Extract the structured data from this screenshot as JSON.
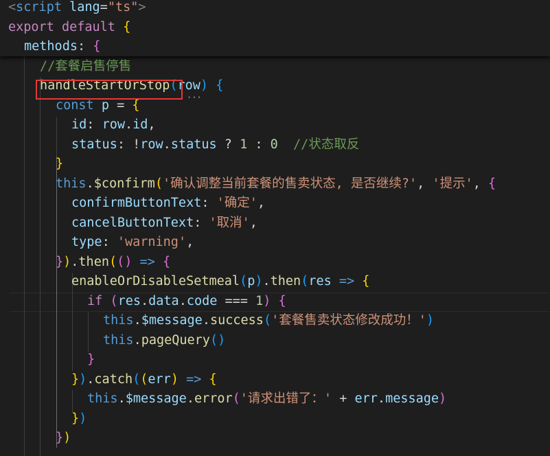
{
  "editor": {
    "language": "ts",
    "lines": [
      {
        "indent": 0,
        "tokens": [
          [
            "c-tag",
            "<"
          ],
          [
            "c-tagname",
            "script"
          ],
          [
            "c-op",
            " "
          ],
          [
            "c-attr",
            "lang"
          ],
          [
            "c-op",
            "="
          ],
          [
            "c-str",
            "\"ts\""
          ],
          [
            "c-tag",
            ">"
          ]
        ]
      },
      {
        "indent": 0,
        "tokens": [
          [
            "c-kw",
            "export"
          ],
          [
            "c-op",
            " "
          ],
          [
            "c-kw",
            "default"
          ],
          [
            "c-op",
            " "
          ],
          [
            "c-brace1",
            "{"
          ]
        ]
      },
      {
        "indent": 1,
        "tokens": [
          [
            "c-prop",
            "methods"
          ],
          [
            "c-op",
            ": "
          ],
          [
            "c-brace2",
            "{"
          ]
        ]
      },
      {
        "indent": 2,
        "tokens": [
          [
            "c-comment",
            "//套餐启售停售"
          ]
        ]
      },
      {
        "indent": 2,
        "tokens": [
          [
            "c-fn",
            "handleStartOrStop"
          ],
          [
            "c-brace3",
            "("
          ],
          [
            "c-var",
            "row"
          ],
          [
            "c-brace3",
            ")"
          ],
          [
            "c-op",
            " "
          ],
          [
            "c-brace3",
            "{"
          ]
        ]
      },
      {
        "indent": 3,
        "tokens": [
          [
            "c-kw2",
            "const"
          ],
          [
            "c-op",
            " "
          ],
          [
            "c-var",
            "p"
          ],
          [
            "c-op",
            " = "
          ],
          [
            "c-brace1",
            "{"
          ]
        ]
      },
      {
        "indent": 4,
        "tokens": [
          [
            "c-prop",
            "id"
          ],
          [
            "c-op",
            ": "
          ],
          [
            "c-var",
            "row"
          ],
          [
            "c-op",
            "."
          ],
          [
            "c-prop",
            "id"
          ],
          [
            "c-op",
            ","
          ]
        ]
      },
      {
        "indent": 4,
        "tokens": [
          [
            "c-prop",
            "status"
          ],
          [
            "c-op",
            ": !"
          ],
          [
            "c-var",
            "row"
          ],
          [
            "c-op",
            "."
          ],
          [
            "c-prop",
            "status"
          ],
          [
            "c-op",
            " ? "
          ],
          [
            "c-num",
            "1"
          ],
          [
            "c-op",
            " : "
          ],
          [
            "c-num",
            "0"
          ],
          [
            "c-op",
            "  "
          ],
          [
            "c-comment",
            "//状态取反"
          ]
        ]
      },
      {
        "indent": 3,
        "tokens": [
          [
            "c-brace1",
            "}"
          ]
        ]
      },
      {
        "indent": 3,
        "tokens": [
          [
            "c-this",
            "this"
          ],
          [
            "c-op",
            "."
          ],
          [
            "c-fn",
            "$confirm"
          ],
          [
            "c-brace1",
            "("
          ],
          [
            "c-str",
            "'确认调整当前套餐的售卖状态, 是否继续?'"
          ],
          [
            "c-op",
            ", "
          ],
          [
            "c-str",
            "'提示'"
          ],
          [
            "c-op",
            ", "
          ],
          [
            "c-brace2",
            "{"
          ]
        ]
      },
      {
        "indent": 4,
        "tokens": [
          [
            "c-prop",
            "confirmButtonText"
          ],
          [
            "c-op",
            ": "
          ],
          [
            "c-str",
            "'确定'"
          ],
          [
            "c-op",
            ","
          ]
        ]
      },
      {
        "indent": 4,
        "tokens": [
          [
            "c-prop",
            "cancelButtonText"
          ],
          [
            "c-op",
            ": "
          ],
          [
            "c-str",
            "'取消'"
          ],
          [
            "c-op",
            ","
          ]
        ]
      },
      {
        "indent": 4,
        "tokens": [
          [
            "c-prop",
            "type"
          ],
          [
            "c-op",
            ": "
          ],
          [
            "c-str",
            "'warning'"
          ],
          [
            "c-op",
            ","
          ]
        ]
      },
      {
        "indent": 3,
        "tokens": [
          [
            "c-brace2",
            "}"
          ],
          [
            "c-brace1",
            ")"
          ],
          [
            "c-op",
            "."
          ],
          [
            "c-fn",
            "then"
          ],
          [
            "c-brace1",
            "("
          ],
          [
            "c-brace2",
            "("
          ],
          [
            "c-brace2",
            ")"
          ],
          [
            "c-op",
            " "
          ],
          [
            "c-kw2",
            "=>"
          ],
          [
            "c-op",
            " "
          ],
          [
            "c-brace2",
            "{"
          ]
        ]
      },
      {
        "indent": 4,
        "tokens": [
          [
            "c-fn",
            "enableOrDisableSetmeal"
          ],
          [
            "c-brace3",
            "("
          ],
          [
            "c-var",
            "p"
          ],
          [
            "c-brace3",
            ")"
          ],
          [
            "c-op",
            "."
          ],
          [
            "c-fn",
            "then"
          ],
          [
            "c-brace3",
            "("
          ],
          [
            "c-var",
            "res"
          ],
          [
            "c-op",
            " "
          ],
          [
            "c-kw2",
            "=>"
          ],
          [
            "c-op",
            " "
          ],
          [
            "c-brace1",
            "{"
          ]
        ]
      },
      {
        "indent": 5,
        "tokens": [
          [
            "c-kw",
            "if"
          ],
          [
            "c-op",
            " "
          ],
          [
            "c-brace2",
            "("
          ],
          [
            "c-var",
            "res"
          ],
          [
            "c-op",
            "."
          ],
          [
            "c-prop",
            "data"
          ],
          [
            "c-op",
            "."
          ],
          [
            "c-prop",
            "code"
          ],
          [
            "c-op",
            " === "
          ],
          [
            "c-num",
            "1"
          ],
          [
            "c-brace2",
            ")"
          ],
          [
            "c-op",
            " "
          ],
          [
            "c-brace2",
            "{"
          ]
        ]
      },
      {
        "indent": 6,
        "tokens": [
          [
            "c-this",
            "this"
          ],
          [
            "c-op",
            "."
          ],
          [
            "c-var",
            "$message"
          ],
          [
            "c-op",
            "."
          ],
          [
            "c-fn",
            "success"
          ],
          [
            "c-brace3",
            "("
          ],
          [
            "c-str",
            "'套餐售卖状态修改成功！'"
          ],
          [
            "c-brace3",
            ")"
          ]
        ]
      },
      {
        "indent": 6,
        "tokens": [
          [
            "c-this",
            "this"
          ],
          [
            "c-op",
            "."
          ],
          [
            "c-fn",
            "pageQuery"
          ],
          [
            "c-brace3",
            "("
          ],
          [
            "c-brace3",
            ")"
          ]
        ]
      },
      {
        "indent": 5,
        "tokens": [
          [
            "c-brace2",
            "}"
          ]
        ]
      },
      {
        "indent": 4,
        "tokens": [
          [
            "c-brace1",
            "}"
          ],
          [
            "c-brace3",
            ")"
          ],
          [
            "c-op",
            "."
          ],
          [
            "c-fn",
            "catch"
          ],
          [
            "c-brace3",
            "("
          ],
          [
            "c-brace1",
            "("
          ],
          [
            "c-var",
            "err"
          ],
          [
            "c-brace1",
            ")"
          ],
          [
            "c-op",
            " "
          ],
          [
            "c-kw2",
            "=>"
          ],
          [
            "c-op",
            " "
          ],
          [
            "c-brace1",
            "{"
          ]
        ]
      },
      {
        "indent": 5,
        "tokens": [
          [
            "c-this",
            "this"
          ],
          [
            "c-op",
            "."
          ],
          [
            "c-var",
            "$message"
          ],
          [
            "c-op",
            "."
          ],
          [
            "c-fn",
            "error"
          ],
          [
            "c-brace2",
            "("
          ],
          [
            "c-str",
            "'请求出错了：'"
          ],
          [
            "c-op",
            " + "
          ],
          [
            "c-var",
            "err"
          ],
          [
            "c-op",
            "."
          ],
          [
            "c-prop",
            "message"
          ],
          [
            "c-brace2",
            ")"
          ]
        ]
      },
      {
        "indent": 4,
        "tokens": [
          [
            "c-brace1",
            "}"
          ],
          [
            "c-brace3",
            ")"
          ]
        ]
      },
      {
        "indent": 3,
        "tokens": [
          [
            "c-brace2",
            "}"
          ],
          [
            "c-brace1",
            ")"
          ]
        ]
      }
    ],
    "highlighted_identifier": "handleStartOrStop"
  }
}
